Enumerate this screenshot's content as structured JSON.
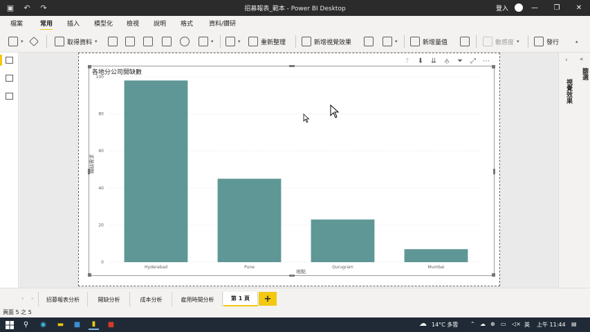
{
  "window": {
    "title": "招募報表_範本 - Power BI Desktop",
    "signin": "登入"
  },
  "menu": {
    "tabs": [
      "檔案",
      "常用",
      "插入",
      "模型化",
      "檢視",
      "說明",
      "格式",
      "資料/鑽研"
    ],
    "active": "常用"
  },
  "ribbon": {
    "get_data": "取得資料",
    "refresh": "重新整理",
    "new_visual": "新增視覺效果",
    "new_measure": "新增量值",
    "sensitivity": "敏感度",
    "publish": "發行"
  },
  "right_pane": {
    "filters": "篩選",
    "visualizations": "視覺效果"
  },
  "chart_data": {
    "type": "bar",
    "title": "各地分公司開缺數",
    "xlabel": "地點",
    "ylabel": "職缺需求",
    "categories": [
      "Hyderabad",
      "Pune",
      "Gurugram",
      "Mumbai"
    ],
    "values": [
      98,
      45,
      23,
      7
    ],
    "ylim": [
      0,
      100
    ],
    "yticks": [
      0,
      20,
      40,
      60,
      80,
      100
    ],
    "color": "#5f9696",
    "grid": true
  },
  "page_tabs": [
    "招募報表分析",
    "開缺分析",
    "成本分析",
    "雇用時間分析",
    "第 1 頁"
  ],
  "active_page": "第 1 頁",
  "add_page": "+",
  "status": {
    "page_indicator": "頁面 5 之 5"
  },
  "taskbar": {
    "weather": "14°C 多雲",
    "ime": "英",
    "time": "上午 11:44"
  },
  "colors": {
    "accent": "#f2c811",
    "bar": "#5f9696"
  }
}
